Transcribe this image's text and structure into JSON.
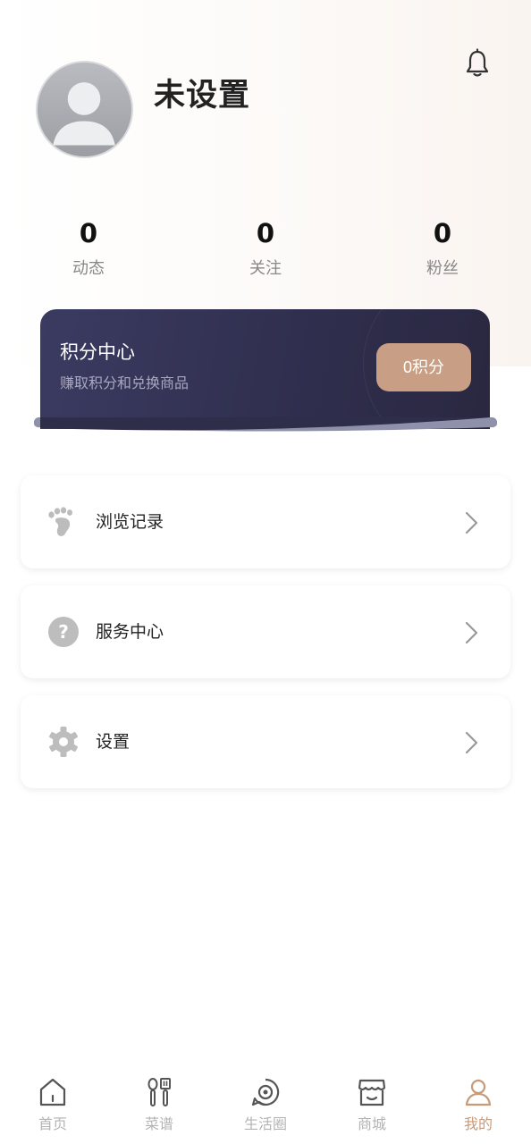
{
  "profile": {
    "username": "未设置"
  },
  "stats": [
    {
      "value": "0",
      "label": "动态"
    },
    {
      "value": "0",
      "label": "关注"
    },
    {
      "value": "0",
      "label": "粉丝"
    }
  ],
  "points": {
    "title": "积分中心",
    "subtitle": "赚取积分和兑换商品",
    "button_label": "0积分"
  },
  "menu": [
    {
      "label": "浏览记录",
      "icon": "footprint-icon"
    },
    {
      "label": "服务中心",
      "icon": "question-icon"
    },
    {
      "label": "设置",
      "icon": "gear-icon"
    }
  ],
  "tabs": [
    {
      "label": "首页",
      "icon": "home-icon"
    },
    {
      "label": "菜谱",
      "icon": "kitchen-utensils-icon"
    },
    {
      "label": "生活圈",
      "icon": "life-circle-icon"
    },
    {
      "label": "商城",
      "icon": "store-icon"
    },
    {
      "label": "我的",
      "icon": "user-icon",
      "active": true
    }
  ],
  "colors": {
    "accent": "#c79a78",
    "points_button": "#c89f84",
    "card_dark": "#2f2e4d"
  }
}
